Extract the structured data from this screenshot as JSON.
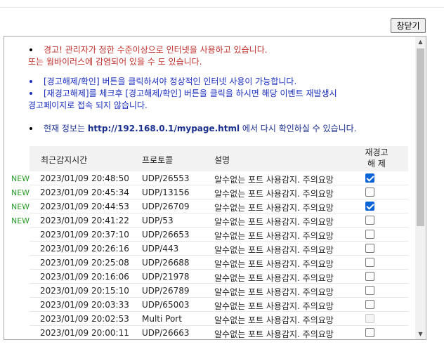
{
  "toolbar": {
    "close_label": "창닫기"
  },
  "messages": {
    "warning_line1": "경고! 관리자가 정한 수준이상으로 인터넷을 사용하고 있습니다.",
    "warning_line2": "또는 웜바이러스에 감염되어 있을 수 도 있습니다.",
    "instruction1": "[경고해제/확인] 버튼을 클릭하셔야 정상적인 인터넷 사용이 가능합니다.",
    "instruction2_line1": "[재경고해제]를 체크후 [경고해제/확인] 버튼을 클릭을 하시면 해당 이벤트 재발생시",
    "instruction2_line2": "경고페이지로 접속 되지 않습니다.",
    "info_prefix": "현재 정보는",
    "info_url": "http://192.168.0.1/mypage.html",
    "info_suffix": "에서 다시 확인하실 수 있습니다."
  },
  "table": {
    "headers": {
      "time": "최근감지시간",
      "protocol": "프로토콜",
      "description": "설명",
      "reset_line1": "재경고",
      "reset_line2": "해 제"
    },
    "rows": [
      {
        "badge": "NEW",
        "time": "2023/01/09 20:48:50",
        "protocol": "UDP/26553",
        "description": "알수없는 포트 사용감지. 주의요망",
        "checked": true,
        "disabled": false
      },
      {
        "badge": "NEW",
        "time": "2023/01/09 20:45:34",
        "protocol": "UDP/13156",
        "description": "알수없는 포트 사용감지. 주의요망",
        "checked": false,
        "disabled": false
      },
      {
        "badge": "NEW",
        "time": "2023/01/09 20:44:53",
        "protocol": "UDP/26709",
        "description": "알수없는 포트 사용감지. 주의요망",
        "checked": true,
        "disabled": false
      },
      {
        "badge": "NEW",
        "time": "2023/01/09 20:41:22",
        "protocol": "UDP/53",
        "description": "알수없는 포트 사용감지. 주의요망",
        "checked": false,
        "disabled": false
      },
      {
        "badge": "",
        "time": "2023/01/09 20:37:10",
        "protocol": "UDP/26653",
        "description": "알수없는 포트 사용감지. 주의요망",
        "checked": false,
        "disabled": false
      },
      {
        "badge": "",
        "time": "2023/01/09 20:26:16",
        "protocol": "UDP/443",
        "description": "알수없는 포트 사용감지. 주의요망",
        "checked": false,
        "disabled": false
      },
      {
        "badge": "",
        "time": "2023/01/09 20:25:08",
        "protocol": "UDP/26688",
        "description": "알수없는 포트 사용감지. 주의요망",
        "checked": false,
        "disabled": false
      },
      {
        "badge": "",
        "time": "2023/01/09 20:16:06",
        "protocol": "UDP/21978",
        "description": "알수없는 포트 사용감지. 주의요망",
        "checked": false,
        "disabled": false
      },
      {
        "badge": "",
        "time": "2023/01/09 20:15:10",
        "protocol": "UDP/26789",
        "description": "알수없는 포트 사용감지. 주의요망",
        "checked": false,
        "disabled": false
      },
      {
        "badge": "",
        "time": "2023/01/09 20:03:33",
        "protocol": "UDP/65003",
        "description": "알수없는 포트 사용감지. 주의요망",
        "checked": false,
        "disabled": false
      },
      {
        "badge": "",
        "time": "2023/01/09 20:02:53",
        "protocol": "Multi Port",
        "description": "알수없는 포트 사용감지. 주의요망",
        "checked": false,
        "disabled": true
      },
      {
        "badge": "",
        "time": "2023/01/09 20:00:11",
        "protocol": "UDP/26663",
        "description": "알수없는 포트 사용감지. 주의요망",
        "checked": false,
        "disabled": false
      }
    ]
  },
  "colors": {
    "warning": "#c0302c",
    "instruction": "#1a2fbf",
    "new_badge": "#2a9a2a",
    "checkbox_checked": "#0b63d8"
  },
  "icons": {
    "scroll_up": "chevron-up-icon",
    "scroll_down": "chevron-down-icon"
  }
}
